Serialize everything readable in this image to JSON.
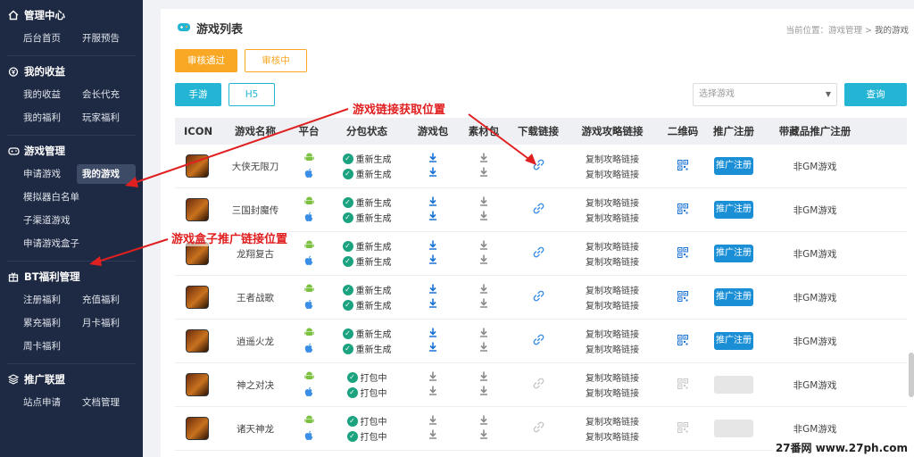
{
  "sidebar": {
    "sections": [
      {
        "title": "管理中心",
        "icon": "home-icon",
        "items": [
          "后台首页",
          "开服预告"
        ]
      },
      {
        "title": "我的收益",
        "icon": "money-icon",
        "items": [
          "我的收益",
          "会长代充",
          "我的福利",
          "玩家福利"
        ]
      },
      {
        "title": "游戏管理",
        "icon": "gamepad-icon",
        "items": [
          "申请游戏",
          "我的游戏",
          "模拟器白名单",
          "子渠道游戏",
          "申请游戏盒子"
        ]
      },
      {
        "title": "BT福利管理",
        "icon": "gift-icon",
        "items": [
          "注册福利",
          "充值福利",
          "累充福利",
          "月卡福利",
          "周卡福利"
        ]
      },
      {
        "title": "推广联盟",
        "icon": "layers-icon",
        "items": [
          "站点申请",
          "文档管理"
        ]
      }
    ]
  },
  "header": {
    "title": "游戏列表",
    "breadcrumb_prefix": "当前位置：",
    "breadcrumb_path": "游戏管理 > ",
    "breadcrumb_current": "我的游戏"
  },
  "filters": {
    "status_tabs": [
      "审核通过",
      "审核中"
    ],
    "platform_tabs": [
      "手游",
      "H5"
    ],
    "select_placeholder": "选择游戏",
    "query_label": "查询"
  },
  "table": {
    "headers": [
      "ICON",
      "游戏名称",
      "平台",
      "分包状态",
      "游戏包",
      "素材包",
      "下载链接",
      "游戏攻略链接",
      "二维码",
      "推广注册",
      "带藏品推广注册"
    ],
    "guide_label": "复制攻略链接",
    "promo_label": "推广注册",
    "rows": [
      {
        "name": "大侠无限刀",
        "status": "重新生成",
        "active": true,
        "tag": "非GM游戏"
      },
      {
        "name": "三国封魔传",
        "status": "重新生成",
        "active": true,
        "tag": "非GM游戏"
      },
      {
        "name": "龙翔复古",
        "status": "重新生成",
        "active": true,
        "tag": "非GM游戏"
      },
      {
        "name": "王者战歌",
        "status": "重新生成",
        "active": true,
        "tag": "非GM游戏"
      },
      {
        "name": "逍遥火龙",
        "status": "重新生成",
        "active": true,
        "tag": "非GM游戏"
      },
      {
        "name": "神之对决",
        "status": "打包中",
        "active": false,
        "tag": "非GM游戏"
      },
      {
        "name": "诸天神龙",
        "status": "打包中",
        "active": false,
        "tag": "非GM游戏"
      }
    ]
  },
  "annotations": {
    "link_position": "游戏链接获取位置",
    "box_link_position": "游戏盒子推广链接位置"
  },
  "watermark": "27番网 www.27ph.com",
  "colors": {
    "accent": "#24b5d5",
    "orange": "#f9a826",
    "annotation": "#e02020",
    "sidebar": "#1e2a44"
  }
}
